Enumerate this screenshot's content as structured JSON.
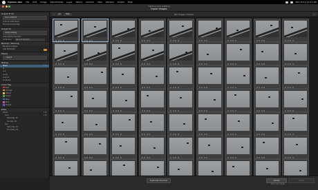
{
  "menubar": {
    "app_name": "Capture One",
    "items": [
      "File",
      "Edit",
      "Image",
      "Adjustments",
      "Layer",
      "Select",
      "Camera",
      "View",
      "Window",
      "Scripts",
      "Help"
    ],
    "clock": "Wed Oct 2 10:17 AM"
  },
  "window": {
    "title": "Capture One Catalog",
    "subtitle": "Import Images"
  },
  "sidebar": {
    "import_from": {
      "header": "Import From",
      "source": "Canon EOS R7",
      "options": [
        "Include Subfolders",
        "Exclude Duplicates"
      ]
    },
    "import_to": {
      "header": "Import To",
      "destination": "Inside Catalog",
      "path": "/Users/Pictures/2024",
      "collection_label": "Collection",
      "collection_value": "Recent Imports"
    },
    "import_options": {
      "header": "Backup / Naming",
      "rows": [
        "Rename Images",
        "Add Metadata"
      ]
    },
    "filters": {
      "header": "Filters",
      "search_placeholder": "Search"
    },
    "rating": {
      "header": "Rating",
      "rows": [
        {
          "label": "None",
          "count": "182"
        },
        {
          "label": "★",
          "count": ""
        },
        {
          "label": "★★",
          "count": ""
        },
        {
          "label": "★★★",
          "count": ""
        },
        {
          "label": "★★★★",
          "count": ""
        },
        {
          "label": "★★★★★",
          "count": ""
        }
      ]
    },
    "color_tag": {
      "header": "Color Tag",
      "rows": [
        {
          "label": "Red",
          "color": "#c33b3b"
        },
        {
          "label": "Orange",
          "color": "#e18a2b"
        },
        {
          "label": "Yellow",
          "color": "#d6c23a"
        },
        {
          "label": "Green",
          "color": "#4aa24a"
        },
        {
          "label": "Blue",
          "color": "#3b6fc3"
        },
        {
          "label": "Pink",
          "color": "#c35aa8"
        },
        {
          "label": "Purple",
          "color": "#7d4fc3"
        }
      ]
    },
    "date": {
      "header": "Date",
      "rows": [
        {
          "label": "2024",
          "count": "182"
        },
        {
          "label": "June",
          "count": "182"
        },
        {
          "label": "Saturday 15",
          "count": ""
        },
        {
          "label": "Sunday 16",
          "count": ""
        },
        {
          "label": "July",
          "count": ""
        },
        {
          "label": "Saturday 13",
          "count": ""
        },
        {
          "label": "Thursday 18",
          "count": ""
        }
      ]
    }
  },
  "toolbar": {
    "all_label": "All",
    "filter_label": "Filter",
    "count_text": "182 Images (Sorted)"
  },
  "bottombar": {
    "duplicate_button": "Duplicate Structure",
    "cancel_button": "Cancel",
    "import_button": "Import",
    "status": "Total 182 Images"
  },
  "icons": {
    "apple": "apple-icon",
    "search": "search-icon",
    "grid_view": "grid-view-icon",
    "list_view": "list-view-icon",
    "close": "close-icon"
  },
  "colors": {
    "accent": "#3f5d78",
    "orange": "#e18a2b"
  }
}
